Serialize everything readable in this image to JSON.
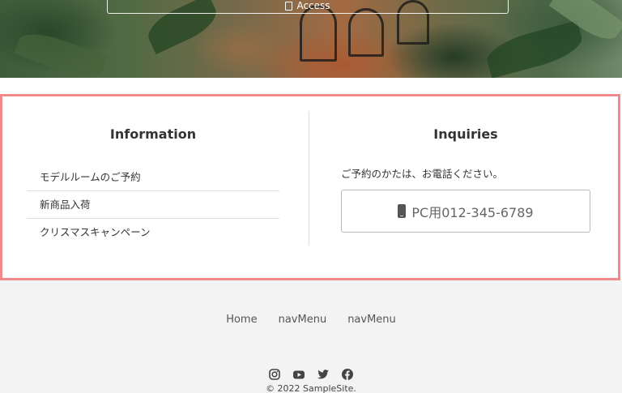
{
  "hero": {
    "access_label": "Access",
    "access_icon": "map-pin-icon"
  },
  "information": {
    "title": "Information",
    "items": [
      {
        "label": "モデルルームのご予約"
      },
      {
        "label": "新商品入荷"
      },
      {
        "label": "クリスマスキャンペーン"
      }
    ]
  },
  "inquiries": {
    "title": "Inquiries",
    "text": "ご予約のかたは、お電話ください。",
    "phone_label": "PC用012-345-6789",
    "phone_icon": "mobile-phone-icon"
  },
  "footer": {
    "nav": [
      {
        "label": "Home"
      },
      {
        "label": "navMenu"
      },
      {
        "label": "navMenu"
      }
    ],
    "socials": [
      "instagram-icon",
      "youtube-icon",
      "twitter-icon",
      "facebook-icon"
    ],
    "copyright": "© 2022 SampleSite."
  },
  "colors": {
    "highlight_border": "#f08a8a",
    "footer_bg": "#f3f3f3"
  }
}
